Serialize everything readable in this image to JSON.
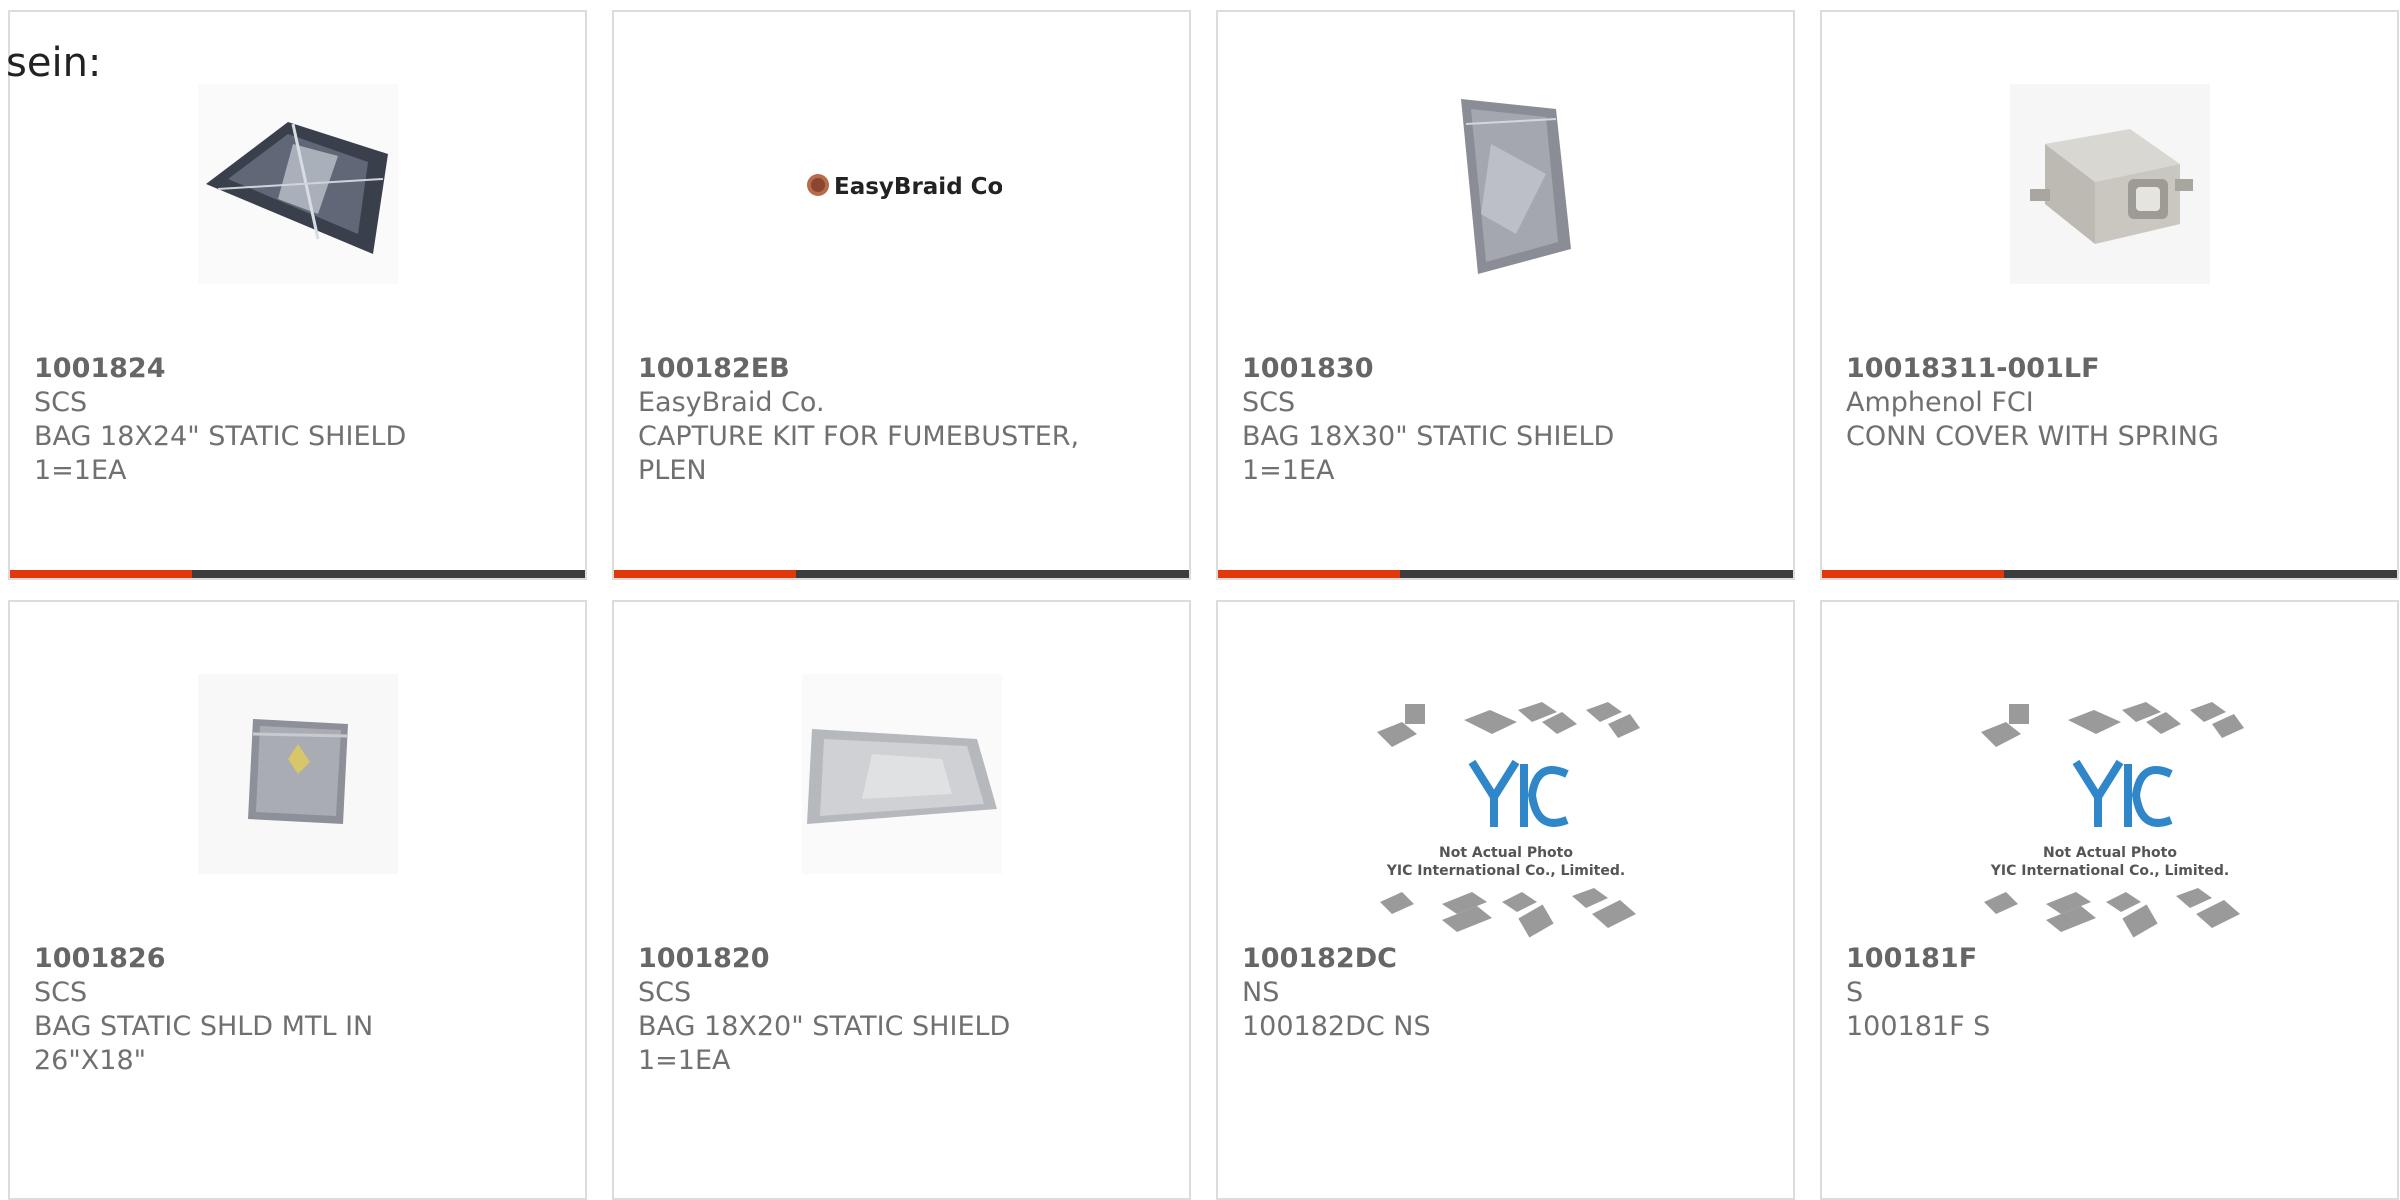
{
  "page_fragment": "sein:",
  "colors": {
    "accent_red": "#e0380b",
    "accent_dark": "#3d3d3d",
    "border": "#dcdcdc",
    "text": "#707070"
  },
  "products": [
    {
      "part_number": "1001824",
      "manufacturer": "SCS",
      "description": "BAG 18X24\" STATIC SHIELD\n1=1EA",
      "image": "static-bag-flat-icon"
    },
    {
      "part_number": "100182EB",
      "manufacturer": "EasyBraid Co.",
      "description": "CAPTURE KIT FOR FUMEBUSTER,\nPLEN",
      "image": "easybraid-logo",
      "logo_text": "EasyBraid Co."
    },
    {
      "part_number": "1001830",
      "manufacturer": "SCS",
      "description": "BAG 18X30\" STATIC SHIELD\n1=1EA",
      "image": "static-bag-tall-icon"
    },
    {
      "part_number": "10018311-001LF",
      "manufacturer": "Amphenol FCI",
      "description": "CONN COVER WITH SPRING",
      "image": "connector-cover-icon"
    },
    {
      "part_number": "1001826",
      "manufacturer": "SCS",
      "description": "BAG STATIC SHLD MTL IN\n26\"X18\"",
      "image": "static-bag-small-icon"
    },
    {
      "part_number": "1001820",
      "manufacturer": "SCS",
      "description": "BAG 18X20\" STATIC SHIELD\n1=1EA",
      "image": "static-bag-clear-icon"
    },
    {
      "part_number": "100182DC",
      "manufacturer": "NS",
      "description": "100182DC NS",
      "image": "yic-placeholder",
      "placeholder_line1": "Not Actual Photo",
      "placeholder_line2": "YIC International Co., Limited.",
      "placeholder_logo": "YIC"
    },
    {
      "part_number": "100181F",
      "manufacturer": "S",
      "description": "100181F S",
      "image": "yic-placeholder",
      "placeholder_line1": "Not Actual Photo",
      "placeholder_line2": "YIC International Co., Limited.",
      "placeholder_logo": "YIC"
    }
  ]
}
